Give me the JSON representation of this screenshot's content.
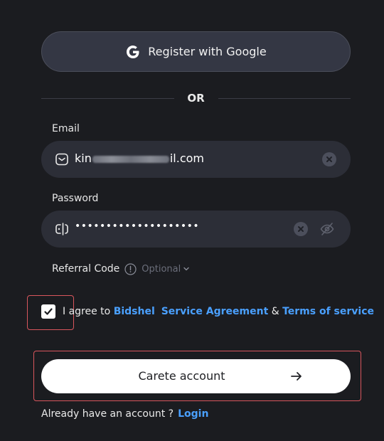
{
  "google": {
    "label": "Register with Google",
    "icon": "google-g-icon"
  },
  "divider": {
    "label": "OR"
  },
  "email": {
    "label": "Email",
    "value_prefix": "kin",
    "value_suffix": "il.com",
    "icon": "mail-icon"
  },
  "password": {
    "label": "Password",
    "value": "••••••••••••••••••••",
    "icon": "password-icon"
  },
  "referral": {
    "label": "Referral Code",
    "optional": "Optional"
  },
  "agree": {
    "checked": true,
    "prefix": "I agree to ",
    "brand": "Bidshel",
    "service": "Service Agreement",
    "amp": " & ",
    "terms": "Terms of service"
  },
  "create": {
    "label": "Carete account"
  },
  "login": {
    "prompt": "Already have an account ?",
    "link": "Login"
  },
  "colors": {
    "background": "#1b1c20",
    "input_bg": "#2c2e37",
    "link": "#4aa0ff",
    "highlight": "#d9565d"
  }
}
